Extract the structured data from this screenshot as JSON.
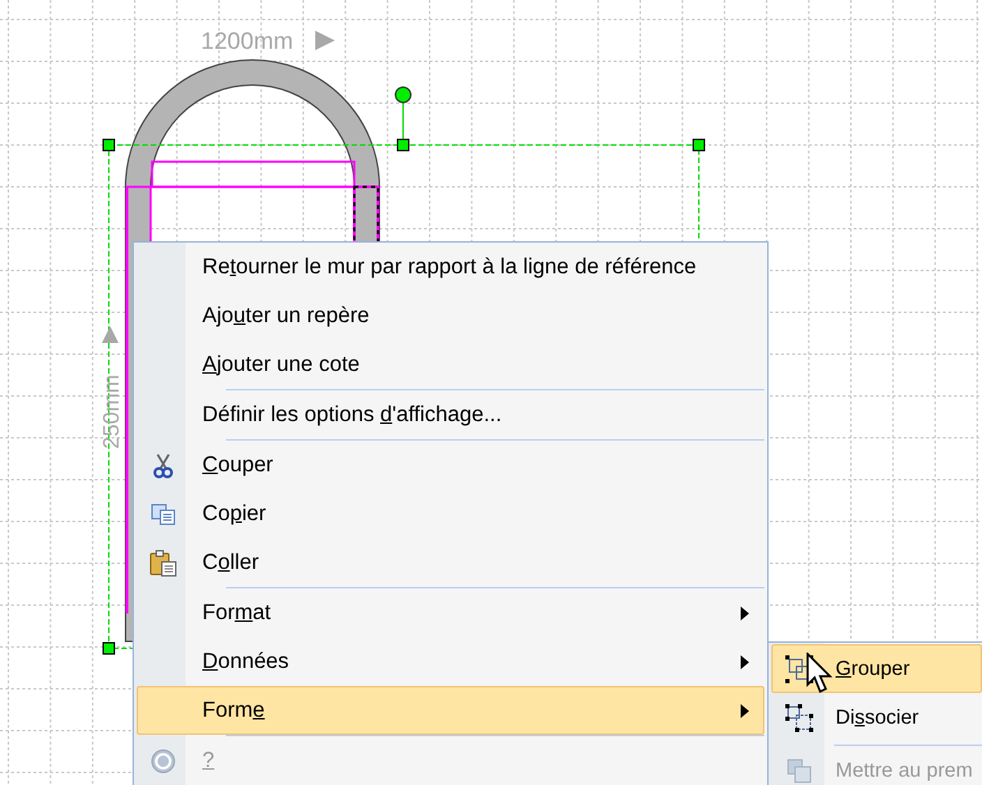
{
  "canvas": {
    "width_label": "1200mm",
    "height_label": "250mm"
  },
  "menu": {
    "items": [
      {
        "kind": "plain",
        "label": {
          "pre": "Re",
          "key": "t",
          "post": "ourner le mur par rapport à la ligne de référence"
        },
        "selected": false,
        "disabled": false,
        "submenu": false
      },
      {
        "kind": "plain",
        "label": {
          "pre": "Ajo",
          "key": "u",
          "post": "ter un repère"
        },
        "selected": false,
        "disabled": false,
        "submenu": false
      },
      {
        "kind": "plain",
        "label": {
          "key": "A",
          "post": "jouter une cote"
        },
        "selected": false,
        "disabled": false,
        "submenu": false
      },
      {
        "kind": "separator"
      },
      {
        "kind": "plain",
        "label": {
          "pre": "Définir les options ",
          "key": "d",
          "post": "'affichage..."
        },
        "selected": false,
        "disabled": false,
        "submenu": false
      },
      {
        "kind": "separator"
      },
      {
        "kind": "cut",
        "label": {
          "key": "C",
          "post": "ouper"
        },
        "selected": false,
        "disabled": false,
        "submenu": false
      },
      {
        "kind": "copy",
        "label": {
          "pre": "Co",
          "key": "p",
          "post": "ier"
        },
        "selected": false,
        "disabled": false,
        "submenu": false
      },
      {
        "kind": "paste",
        "label": {
          "pre": "C",
          "key": "o",
          "post": "ller"
        },
        "selected": false,
        "disabled": false,
        "submenu": false
      },
      {
        "kind": "separator"
      },
      {
        "kind": "plain",
        "label": {
          "pre": "For",
          "key": "m",
          "post": "at"
        },
        "selected": false,
        "disabled": false,
        "submenu": true
      },
      {
        "kind": "plain",
        "label": {
          "key": "D",
          "post": "onnées"
        },
        "selected": false,
        "disabled": false,
        "submenu": true
      },
      {
        "kind": "plain",
        "label": {
          "pre": "Form",
          "key": "e"
        },
        "selected": true,
        "disabled": false,
        "submenu": true
      },
      {
        "kind": "separator"
      },
      {
        "kind": "help",
        "label": {
          "key": "?"
        },
        "selected": false,
        "disabled": true,
        "submenu": false
      }
    ]
  },
  "submenu": {
    "items": [
      {
        "kind": "group",
        "label": {
          "key": "G",
          "post": "rouper"
        },
        "selected": true,
        "disabled": false
      },
      {
        "kind": "ungroup",
        "label": {
          "pre": "Di",
          "key": "s",
          "post": "socier"
        },
        "selected": false,
        "disabled": false
      },
      {
        "kind": "separator"
      },
      {
        "kind": "front",
        "label": {
          "pre": "Mettre au prem"
        },
        "selected": false,
        "disabled": true
      }
    ]
  }
}
